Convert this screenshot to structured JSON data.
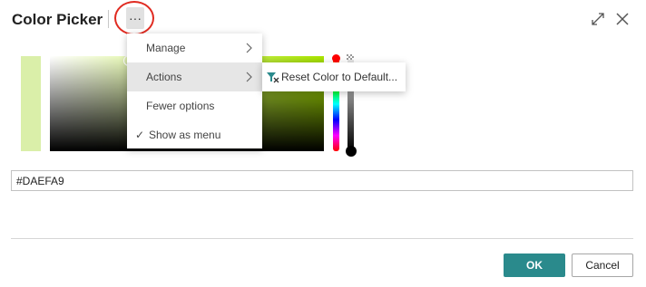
{
  "dialog": {
    "title": "Color Picker",
    "more_label": "···"
  },
  "picker": {
    "selected_color": "#DAEFA9",
    "hue_color": "#AAE600",
    "hex_value": "#DAEFA9"
  },
  "menu": {
    "items": [
      {
        "label": "Manage",
        "has_submenu": true
      },
      {
        "label": "Actions",
        "has_submenu": true
      },
      {
        "label": "Fewer options",
        "has_submenu": false
      },
      {
        "label": "Show as menu",
        "checked": true
      }
    ],
    "check_mark": "✓"
  },
  "submenu": {
    "items": [
      {
        "label": "Reset Color to Default...",
        "icon": "reset-color-icon"
      }
    ]
  },
  "footer": {
    "ok_label": "OK",
    "cancel_label": "Cancel"
  },
  "colors": {
    "accent": "#2A8A8C",
    "highlight": "#E02A20"
  }
}
